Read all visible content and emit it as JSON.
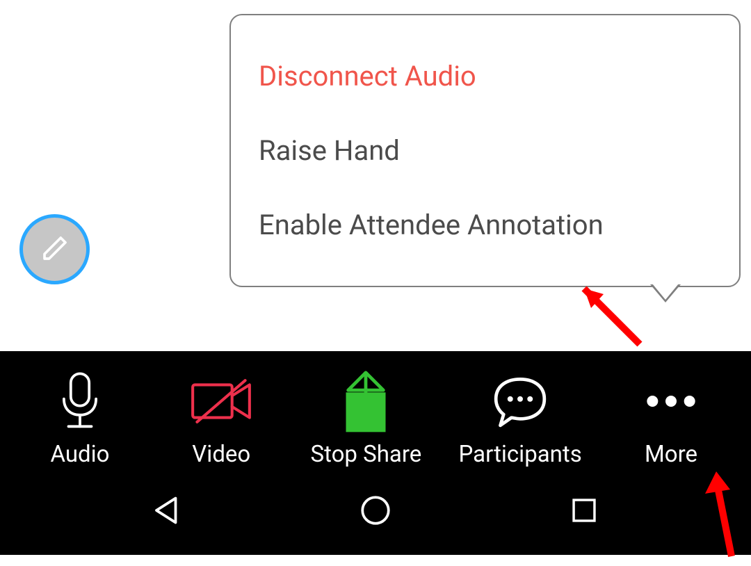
{
  "popup": {
    "items": [
      {
        "label": "Disconnect Audio",
        "danger": true
      },
      {
        "label": "Raise Hand",
        "danger": false
      },
      {
        "label": "Enable Attendee Annotation",
        "danger": false
      }
    ]
  },
  "toolbar": {
    "audio": "Audio",
    "video": "Video",
    "stop_share": "Stop Share",
    "participants": "Participants",
    "more": "More"
  }
}
